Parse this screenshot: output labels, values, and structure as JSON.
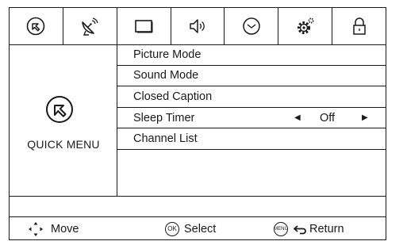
{
  "tabs": [
    {
      "icon": "quick-menu-icon"
    },
    {
      "icon": "satellite-dish-icon"
    },
    {
      "icon": "screen-icon"
    },
    {
      "icon": "speaker-icon"
    },
    {
      "icon": "clock-icon"
    },
    {
      "icon": "gear-icon"
    },
    {
      "icon": "lock-icon"
    }
  ],
  "left_panel": {
    "label": "QUICK MENU",
    "icon": "quick-menu-icon"
  },
  "menu": {
    "items": [
      {
        "label": "Picture Mode"
      },
      {
        "label": "Sound Mode"
      },
      {
        "label": "Closed Caption"
      },
      {
        "label": "Sleep Timer",
        "value": "Off",
        "arrow_left": "◀",
        "arrow_right": "▶"
      },
      {
        "label": "Channel List"
      }
    ]
  },
  "footer": {
    "move_label": "Move",
    "ok_badge": "OK",
    "select_label": "Select",
    "menu_badge": "MENU",
    "return_label": "Return"
  }
}
